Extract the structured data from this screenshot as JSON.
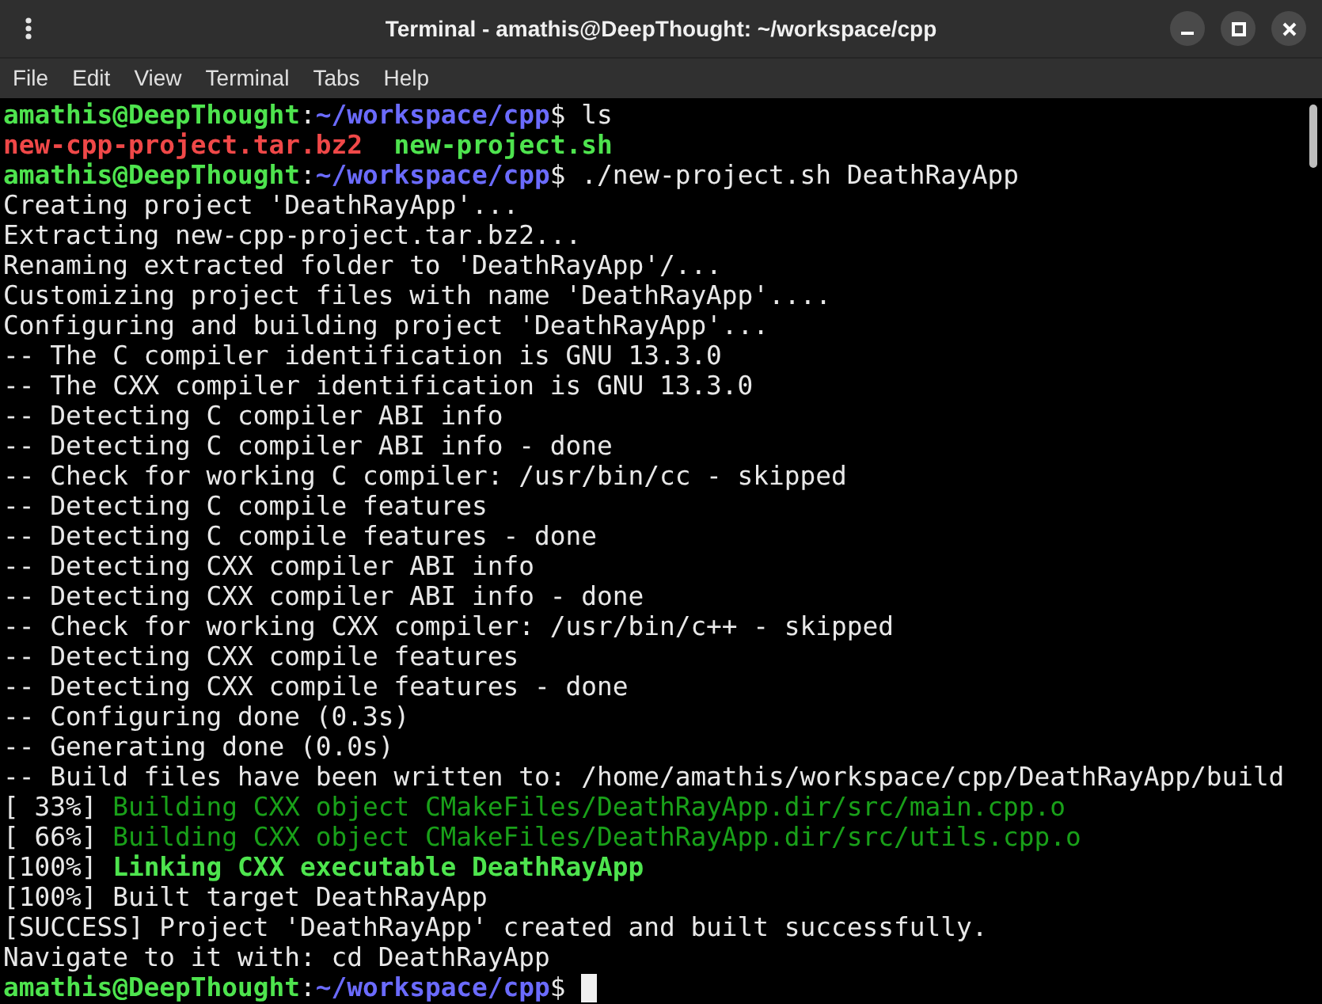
{
  "window": {
    "title": "Terminal - amathis@DeepThought: ~/workspace/cpp"
  },
  "menu": [
    "File",
    "Edit",
    "View",
    "Terminal",
    "Tabs",
    "Help"
  ],
  "terminal": {
    "cursor": true,
    "lines": [
      {
        "segments": [
          {
            "kind": "user",
            "text": "amathis@DeepThought"
          },
          {
            "kind": "plain",
            "text": ":"
          },
          {
            "kind": "path",
            "text": "~/workspace/cpp"
          },
          {
            "kind": "plain",
            "text": "$ ls"
          }
        ]
      },
      {
        "segments": [
          {
            "kind": "archive",
            "text": "new-cpp-project.tar.bz2"
          },
          {
            "kind": "executable",
            "text": "new-project.sh"
          }
        ]
      },
      {
        "segments": [
          {
            "kind": "user",
            "text": "amathis@DeepThought"
          },
          {
            "kind": "plain",
            "text": ":"
          },
          {
            "kind": "path",
            "text": "~/workspace/cpp"
          },
          {
            "kind": "plain",
            "text": "$ ./new-project.sh DeathRayApp"
          }
        ]
      },
      {
        "segments": [
          {
            "kind": "plain",
            "text": "Creating project 'DeathRayApp'..."
          }
        ]
      },
      {
        "segments": [
          {
            "kind": "plain",
            "text": "Extracting new-cpp-project.tar.bz2..."
          }
        ]
      },
      {
        "segments": [
          {
            "kind": "plain",
            "text": "Renaming extracted folder to 'DeathRayApp'/..."
          }
        ]
      },
      {
        "segments": [
          {
            "kind": "plain",
            "text": "Customizing project files with name 'DeathRayApp'...."
          }
        ]
      },
      {
        "segments": [
          {
            "kind": "plain",
            "text": "Configuring and building project 'DeathRayApp'..."
          }
        ]
      },
      {
        "segments": [
          {
            "kind": "plain",
            "text": "-- The C compiler identification is GNU 13.3.0"
          }
        ]
      },
      {
        "segments": [
          {
            "kind": "plain",
            "text": "-- The CXX compiler identification is GNU 13.3.0"
          }
        ]
      },
      {
        "segments": [
          {
            "kind": "plain",
            "text": "-- Detecting C compiler ABI info"
          }
        ]
      },
      {
        "segments": [
          {
            "kind": "plain",
            "text": "-- Detecting C compiler ABI info - done"
          }
        ]
      },
      {
        "segments": [
          {
            "kind": "plain",
            "text": "-- Check for working C compiler: /usr/bin/cc - skipped"
          }
        ]
      },
      {
        "segments": [
          {
            "kind": "plain",
            "text": "-- Detecting C compile features"
          }
        ]
      },
      {
        "segments": [
          {
            "kind": "plain",
            "text": "-- Detecting C compile features - done"
          }
        ]
      },
      {
        "segments": [
          {
            "kind": "plain",
            "text": "-- Detecting CXX compiler ABI info"
          }
        ]
      },
      {
        "segments": [
          {
            "kind": "plain",
            "text": "-- Detecting CXX compiler ABI info - done"
          }
        ]
      },
      {
        "segments": [
          {
            "kind": "plain",
            "text": "-- Check for working CXX compiler: /usr/bin/c++ - skipped"
          }
        ]
      },
      {
        "segments": [
          {
            "kind": "plain",
            "text": "-- Detecting CXX compile features"
          }
        ]
      },
      {
        "segments": [
          {
            "kind": "plain",
            "text": "-- Detecting CXX compile features - done"
          }
        ]
      },
      {
        "segments": [
          {
            "kind": "plain",
            "text": "-- Configuring done (0.3s)"
          }
        ]
      },
      {
        "segments": [
          {
            "kind": "plain",
            "text": "-- Generating done (0.0s)"
          }
        ]
      },
      {
        "segments": [
          {
            "kind": "plain",
            "text": "-- Build files have been written to: /home/amathis/workspace/cpp/DeathRayApp/build"
          }
        ]
      },
      {
        "segments": [
          {
            "kind": "plain",
            "text": "[ 33%] "
          },
          {
            "kind": "build",
            "text": "Building CXX object CMakeFiles/DeathRayApp.dir/src/main.cpp.o"
          }
        ]
      },
      {
        "segments": [
          {
            "kind": "plain",
            "text": "[ 66%] "
          },
          {
            "kind": "build",
            "text": "Building CXX object CMakeFiles/DeathRayApp.dir/src/utils.cpp.o"
          }
        ]
      },
      {
        "segments": [
          {
            "kind": "plain",
            "text": "[100%] "
          },
          {
            "kind": "link",
            "text": "Linking CXX executable DeathRayApp"
          }
        ]
      },
      {
        "segments": [
          {
            "kind": "plain",
            "text": "[100%] Built target DeathRayApp"
          }
        ]
      },
      {
        "segments": [
          {
            "kind": "plain",
            "text": "[SUCCESS] Project 'DeathRayApp' created and built successfully."
          }
        ]
      },
      {
        "segments": [
          {
            "kind": "plain",
            "text": "Navigate to it with: cd DeathRayApp"
          }
        ]
      },
      {
        "segments": [
          {
            "kind": "user",
            "text": "amathis@DeepThought"
          },
          {
            "kind": "plain",
            "text": ":"
          },
          {
            "kind": "path",
            "text": "~/workspace/cpp"
          },
          {
            "kind": "plain",
            "text": "$ "
          }
        ]
      }
    ]
  }
}
